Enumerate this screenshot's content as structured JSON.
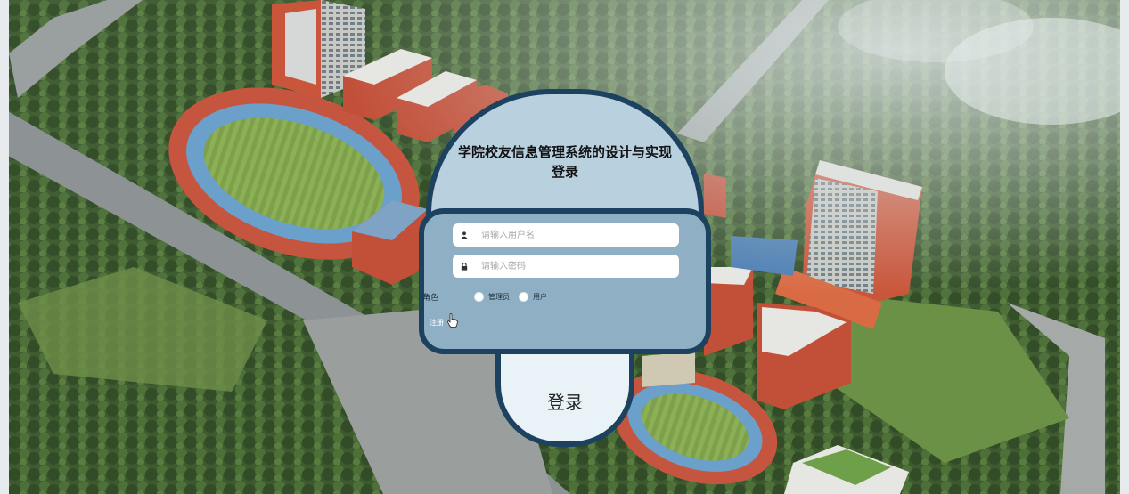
{
  "login": {
    "title": "学院校友信息管理系统的设计与实现",
    "subtitle": "登录",
    "username_placeholder": "请输入用户名",
    "password_placeholder": "请输入密码",
    "role_label": "角色",
    "role_options": [
      "管理员",
      "用户"
    ],
    "register_link": "注册",
    "submit_label": "登录"
  },
  "icons": {
    "user": "user-icon",
    "lock": "lock-icon",
    "cursor": "hand-cursor-icon"
  },
  "colors": {
    "card_border": "#1c4260",
    "dome_fill": "#b9d0de",
    "body_fill": "#8fb0c4",
    "button_fill": "#e9f2f6"
  }
}
